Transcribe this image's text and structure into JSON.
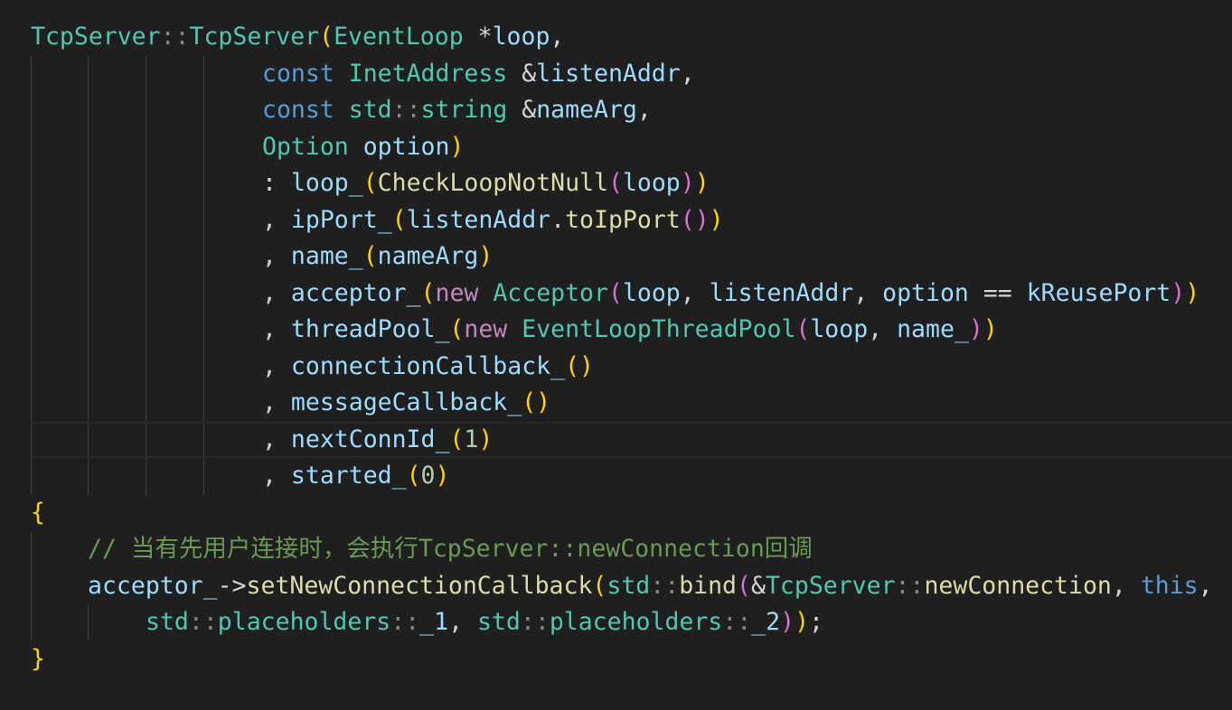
{
  "editor": {
    "theme_colors": {
      "background": "#1f1f1f",
      "type": "#4ec9b0",
      "keyword": "#569cd6",
      "control_keyword": "#c586c0",
      "function": "#dcdcaa",
      "variable": "#9cdcfe",
      "number": "#b5cea8",
      "comment": "#6a9955",
      "bracket_level1": "#ffd700",
      "bracket_level2": "#da70d6",
      "bracket_level3": "#179fff"
    },
    "lines": [
      [
        [
          "type",
          "TcpServer"
        ],
        [
          "dim",
          "::"
        ],
        [
          "type",
          "TcpServer"
        ],
        [
          "b1",
          "("
        ],
        [
          "type",
          "EventLoop"
        ],
        [
          "op",
          " *"
        ],
        [
          "var",
          "loop"
        ],
        [
          "op",
          ","
        ]
      ],
      [
        [
          "kw",
          "const"
        ],
        [
          "op",
          " "
        ],
        [
          "type",
          "InetAddress"
        ],
        [
          "op",
          " &"
        ],
        [
          "var",
          "listenAddr"
        ],
        [
          "op",
          ","
        ]
      ],
      [
        [
          "kw",
          "const"
        ],
        [
          "op",
          " "
        ],
        [
          "type",
          "std"
        ],
        [
          "dim",
          "::"
        ],
        [
          "type",
          "string"
        ],
        [
          "op",
          " &"
        ],
        [
          "var",
          "nameArg"
        ],
        [
          "op",
          ","
        ]
      ],
      [
        [
          "type",
          "Option"
        ],
        [
          "op",
          " "
        ],
        [
          "var",
          "option"
        ],
        [
          "b1",
          ")"
        ]
      ],
      [
        [
          "op",
          ": "
        ],
        [
          "var",
          "loop_"
        ],
        [
          "b1",
          "("
        ],
        [
          "fn",
          "CheckLoopNotNull"
        ],
        [
          "b2",
          "("
        ],
        [
          "var",
          "loop"
        ],
        [
          "b2",
          ")"
        ],
        [
          "b1",
          ")"
        ]
      ],
      [
        [
          "op",
          ", "
        ],
        [
          "var",
          "ipPort_"
        ],
        [
          "b1",
          "("
        ],
        [
          "var",
          "listenAddr"
        ],
        [
          "op",
          "."
        ],
        [
          "fn",
          "toIpPort"
        ],
        [
          "b2",
          "()"
        ],
        [
          "b1",
          ")"
        ]
      ],
      [
        [
          "op",
          ", "
        ],
        [
          "var",
          "name_"
        ],
        [
          "b1",
          "("
        ],
        [
          "var",
          "nameArg"
        ],
        [
          "b1",
          ")"
        ]
      ],
      [
        [
          "op",
          ", "
        ],
        [
          "var",
          "acceptor_"
        ],
        [
          "b1",
          "("
        ],
        [
          "kw2",
          "new"
        ],
        [
          "op",
          " "
        ],
        [
          "type",
          "Acceptor"
        ],
        [
          "b2",
          "("
        ],
        [
          "var",
          "loop"
        ],
        [
          "op",
          ", "
        ],
        [
          "var",
          "listenAddr"
        ],
        [
          "op",
          ", "
        ],
        [
          "var",
          "option"
        ],
        [
          "op",
          " == "
        ],
        [
          "var",
          "kReusePort"
        ],
        [
          "b2",
          ")"
        ],
        [
          "b1",
          ")"
        ]
      ],
      [
        [
          "op",
          ", "
        ],
        [
          "var",
          "threadPool_"
        ],
        [
          "b1",
          "("
        ],
        [
          "kw2",
          "new"
        ],
        [
          "op",
          " "
        ],
        [
          "type",
          "EventLoopThreadPool"
        ],
        [
          "b2",
          "("
        ],
        [
          "var",
          "loop"
        ],
        [
          "op",
          ", "
        ],
        [
          "var",
          "name_"
        ],
        [
          "b2",
          ")"
        ],
        [
          "b1",
          ")"
        ]
      ],
      [
        [
          "op",
          ", "
        ],
        [
          "var",
          "connectionCallback_"
        ],
        [
          "b1",
          "()"
        ]
      ],
      [
        [
          "op",
          ", "
        ],
        [
          "var",
          "messageCallback_"
        ],
        [
          "b1",
          "()"
        ]
      ],
      [
        [
          "op",
          ", "
        ],
        [
          "var",
          "nextConnId_"
        ],
        [
          "b1",
          "("
        ],
        [
          "num",
          "1"
        ],
        [
          "b1",
          ")"
        ]
      ],
      [
        [
          "op",
          ", "
        ],
        [
          "var",
          "started_"
        ],
        [
          "b1",
          "("
        ],
        [
          "num",
          "0"
        ],
        [
          "b1",
          ")"
        ]
      ],
      [
        [
          "b1",
          "{"
        ]
      ],
      [
        [
          "cm",
          "// 当有先用户连接时，会执行TcpServer::newConnection回调"
        ]
      ],
      [
        [
          "var",
          "acceptor_"
        ],
        [
          "op",
          "->"
        ],
        [
          "fn",
          "setNewConnectionCallback"
        ],
        [
          "b1",
          "("
        ],
        [
          "type",
          "std"
        ],
        [
          "dim",
          "::"
        ],
        [
          "fn",
          "bind"
        ],
        [
          "b2",
          "("
        ],
        [
          "op",
          "&"
        ],
        [
          "type",
          "TcpServer"
        ],
        [
          "dim",
          "::"
        ],
        [
          "fn",
          "newConnection"
        ],
        [
          "op",
          ", "
        ],
        [
          "kw",
          "this"
        ],
        [
          "op",
          ","
        ]
      ],
      [
        [
          "type",
          "std"
        ],
        [
          "dim",
          "::"
        ],
        [
          "type",
          "placeholders"
        ],
        [
          "dim",
          "::"
        ],
        [
          "var",
          "_1"
        ],
        [
          "op",
          ", "
        ],
        [
          "type",
          "std"
        ],
        [
          "dim",
          "::"
        ],
        [
          "type",
          "placeholders"
        ],
        [
          "dim",
          "::"
        ],
        [
          "var",
          "_2"
        ],
        [
          "b2",
          ")"
        ],
        [
          "b1",
          ")"
        ],
        [
          "op",
          ";"
        ]
      ],
      [
        [
          "b1",
          "}"
        ]
      ]
    ]
  }
}
